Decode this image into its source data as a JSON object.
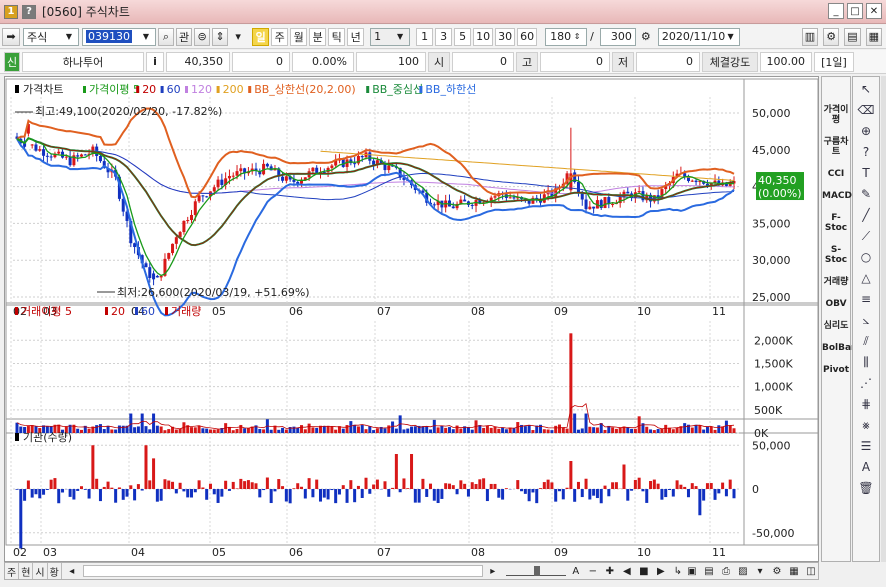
{
  "window": {
    "title": "[0560] 주식차트",
    "icon1": "1",
    "icon2": "?"
  },
  "toolbar1": {
    "market": "주식",
    "code": "039130",
    "btn_search": "search-icon",
    "btn_gwan": "관",
    "periods": [
      "일",
      "주",
      "월",
      "분",
      "틱",
      "년"
    ],
    "active_period": "일",
    "interval_value": "1",
    "minute_buttons": [
      "1",
      "3",
      "5",
      "10",
      "30",
      "60"
    ],
    "count": "180",
    "slash": "/",
    "total": "300",
    "date": "2020/11/10"
  },
  "toolbar2": {
    "badge": "신",
    "name": "하나투어",
    "info_btn": "i",
    "price": "40,350",
    "change": "0",
    "rate": "0.00%",
    "volume": "100",
    "open_label": "시",
    "open": "0",
    "high_label": "고",
    "high": "0",
    "low_label": "저",
    "low": "0",
    "strength_label": "체결강도",
    "strength": "100.00",
    "period_tag": "[1일]"
  },
  "main_chart": {
    "legend_title": "가격차트",
    "legend": [
      {
        "label": "가격이평 5",
        "color": "#1a9a1a"
      },
      {
        "label": "20",
        "color": "#c00000"
      },
      {
        "label": "60",
        "color": "#1f3fbf"
      },
      {
        "label": "120",
        "color": "#c080e0"
      },
      {
        "label": "200",
        "color": "#e0a020"
      },
      {
        "label": "BB_상한선(20,2.00)",
        "color": "#e06020"
      },
      {
        "label": "BB_중심선",
        "color": "#1a8a3a"
      },
      {
        "label": "BB_하한선",
        "color": "#2a6ae0"
      }
    ],
    "max_annotation": "최고:49,100(2020/02/20, -17.82%)",
    "min_annotation": "최저:26,600(2020/03/19, +51.69%)",
    "y_ticks": [
      "50,000",
      "45,000",
      "40,000",
      "35,000",
      "30,000",
      "25,000"
    ],
    "current_price": "40,350",
    "current_rate": "(0.00%)",
    "months": [
      "02",
      "03",
      "04",
      "05",
      "06",
      "07",
      "08",
      "09",
      "10",
      "11"
    ]
  },
  "volume_chart": {
    "legend_title": "거래이평 5",
    "legend": [
      {
        "label": "20",
        "color": "#c00000"
      },
      {
        "label": "60",
        "color": "#1f3fbf"
      },
      {
        "label": "거래량",
        "color": "#c00000"
      }
    ],
    "y_ticks": [
      "2,000K",
      "1,500K",
      "1,000K",
      "500K",
      "0K"
    ]
  },
  "inst_chart": {
    "legend_title": "기관(수량)",
    "y_ticks": [
      "50,000",
      "0",
      "-50,000"
    ],
    "months": [
      "02",
      "03",
      "04",
      "05",
      "06",
      "07",
      "08",
      "09",
      "10",
      "11"
    ]
  },
  "palette": {
    "items": [
      "가격이평",
      "구름차트",
      "CCI",
      "MACD",
      "F-Stoc",
      "S-Stoc",
      "거래량",
      "OBV",
      "심리도",
      "BolBand",
      "Pivot"
    ]
  },
  "bottom": {
    "tabs": [
      "주",
      "현",
      "시",
      "황"
    ]
  },
  "colors": {
    "up": "#d81818",
    "down": "#1030c0",
    "grid": "#c8c8c8"
  },
  "chart_data": {
    "type": "candlestick",
    "title": "가격차트",
    "y_range": [
      25000,
      50000
    ],
    "x_label": "date",
    "months": [
      "02",
      "03",
      "04",
      "05",
      "06",
      "07",
      "08",
      "09",
      "10",
      "11"
    ]
  }
}
